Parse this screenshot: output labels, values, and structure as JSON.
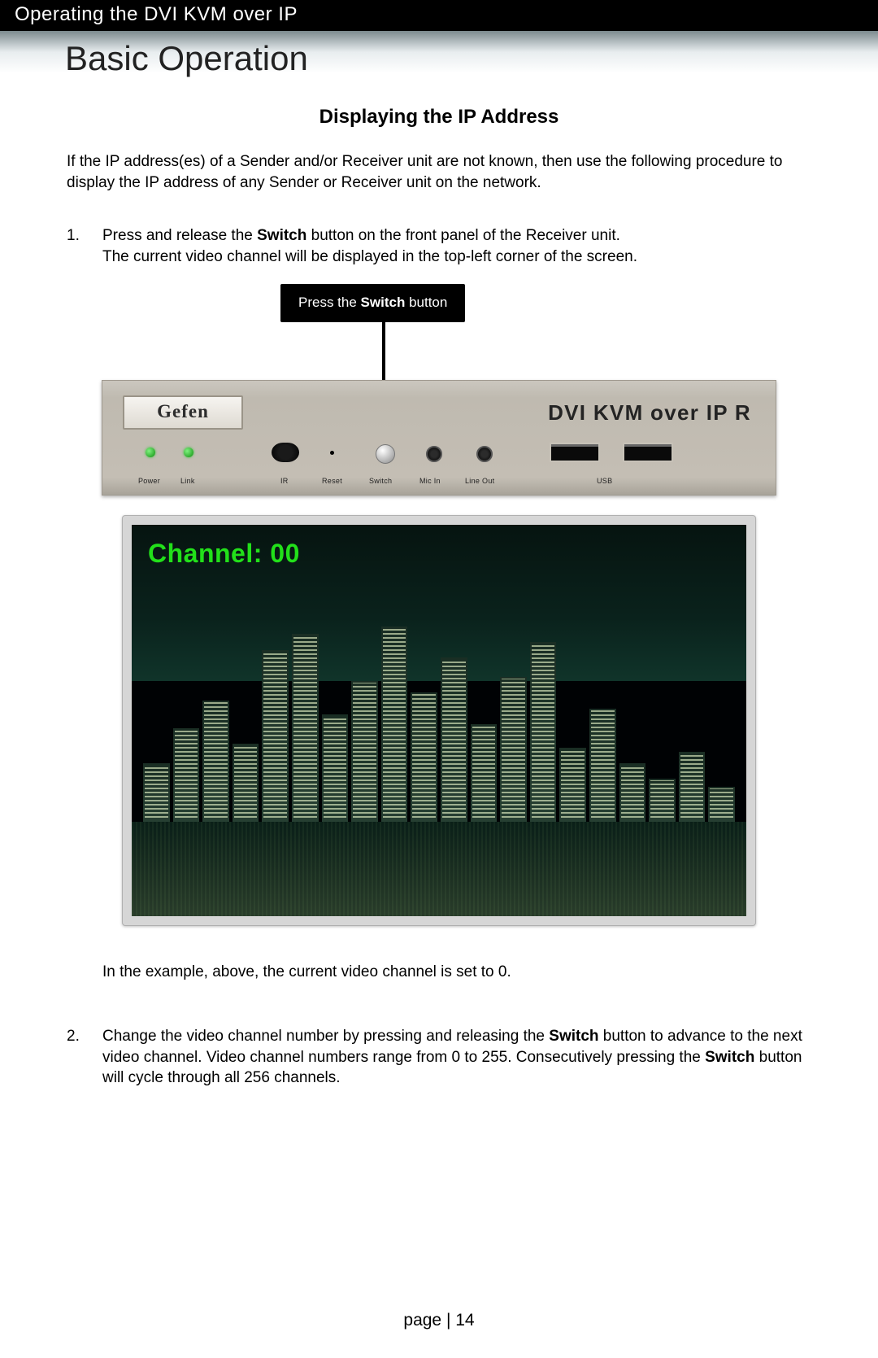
{
  "header": {
    "chapter": "Operating the DVI KVM over IP"
  },
  "title": "Basic Operation",
  "subtitle": "Displaying the IP Address",
  "intro": "If the IP address(es) of a Sender and/or Receiver unit are not known, then use the following procedure to display the IP address of any Sender or Receiver unit on the network.",
  "steps": {
    "s1": {
      "num": "1.",
      "line_a_pre": "Press and release the ",
      "line_a_bold": "Switch",
      "line_a_post": " button on the front panel of the Receiver unit.",
      "line_b": "The current video channel will be displayed in the top-left corner of the screen."
    },
    "s1_after": "In the example, above, the current video channel is set to 0.",
    "s2": {
      "num": "2.",
      "a_pre": "Change the video channel number by pressing and releasing the ",
      "a_bold": "Switch",
      "a_post": " button to advance to the next video channel.  Video channel numbers range from 0 to 255.  Consecutively pressing the ",
      "b_bold": "Switch",
      "b_post": " button will cycle through all 256 channels."
    }
  },
  "callout": {
    "pre": "Press the ",
    "bold": "Switch",
    "post": " button"
  },
  "device": {
    "brand": "Gefen",
    "model": "DVI KVM over IP R",
    "labels": {
      "power": "Power",
      "link": "Link",
      "ir": "IR",
      "reset": "Reset",
      "switch": "Switch",
      "mic": "Mic In",
      "line": "Line Out",
      "usb": "USB"
    }
  },
  "screen": {
    "overlay": "Channel: 00"
  },
  "footer": {
    "label": "page | 14"
  }
}
